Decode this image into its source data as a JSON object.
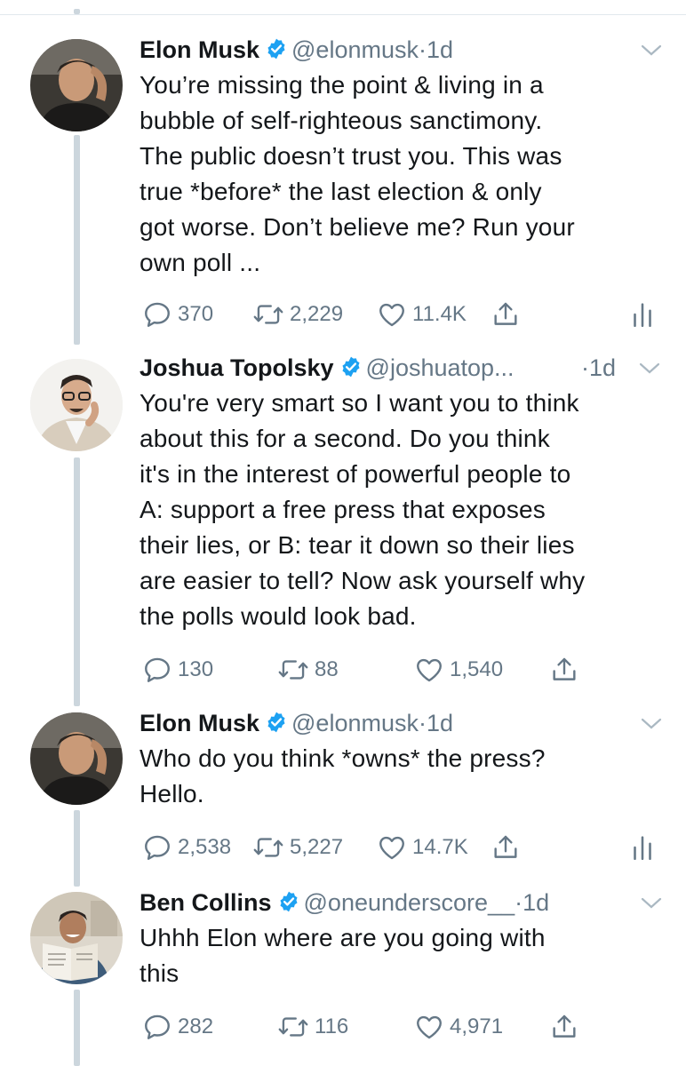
{
  "tweets": [
    {
      "name": "Elon Musk",
      "handle": "@elonmusk",
      "separator": "·",
      "time": "1d",
      "text_lines": [
        "You’re missing the point & living in a",
        "bubble of self-righteous sanctimony.",
        "The public doesn’t trust you. This was",
        "true *before* the last election & only",
        "got worse. Don’t believe me? Run your",
        "own poll ..."
      ],
      "replies": "370",
      "retweets": "2,229",
      "likes": "11.4K",
      "analytics": true
    },
    {
      "name": "Joshua Topolsky",
      "handle": "@joshuatop...",
      "separator": "·",
      "time": "1d",
      "text_lines": [
        "You're very smart so I want you to think",
        "about this for a second. Do you think",
        "it's in the interest of powerful people to",
        "A: support a free press that exposes",
        "their lies, or B: tear it down so their lies",
        "are easier to tell? Now ask yourself why",
        "the polls would look bad."
      ],
      "replies": "130",
      "retweets": "88",
      "likes": "1,540",
      "analytics": false
    },
    {
      "name": "Elon Musk",
      "handle": "@elonmusk",
      "separator": "·",
      "time": "1d",
      "text_lines": [
        "Who do you think *owns* the press?",
        "Hello."
      ],
      "replies": "2,538",
      "retweets": "5,227",
      "likes": "14.7K",
      "analytics": true
    },
    {
      "name": "Ben Collins",
      "handle": "@oneunderscore__",
      "separator": "·",
      "time": "1d",
      "text_lines": [
        "Uhhh Elon where are you going with",
        "this"
      ],
      "replies": "282",
      "retweets": "116",
      "likes": "4,971",
      "analytics": false
    }
  ],
  "colors": {
    "verified_badge": "#1da1f2",
    "secondary_text": "#657786",
    "thread_line": "#ccd6dd",
    "body_text": "#14171a"
  },
  "icons": [
    "reply-icon",
    "retweet-icon",
    "like-icon",
    "share-icon",
    "analytics-icon",
    "verified-badge-icon",
    "chevron-down-icon"
  ]
}
